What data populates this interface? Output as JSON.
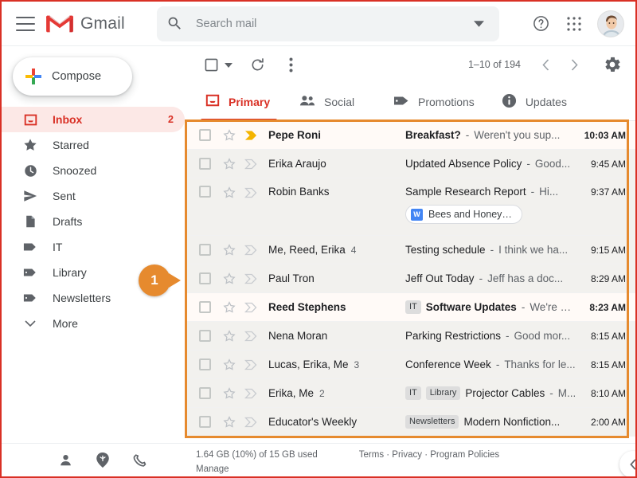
{
  "header": {
    "menu_icon": "hamburger-menu-icon",
    "brand": "Gmail",
    "search_placeholder": "Search mail",
    "search_value": "",
    "help_icon": "help-icon",
    "apps_icon": "apps-grid-icon",
    "avatar_alt": "account-avatar"
  },
  "sidebar": {
    "compose_label": "Compose",
    "items": [
      {
        "label": "Inbox",
        "icon": "inbox-icon",
        "count": "2",
        "active": true
      },
      {
        "label": "Starred",
        "icon": "star-icon",
        "count": "",
        "active": false
      },
      {
        "label": "Snoozed",
        "icon": "clock-icon",
        "count": "",
        "active": false
      },
      {
        "label": "Sent",
        "icon": "send-icon",
        "count": "",
        "active": false
      },
      {
        "label": "Drafts",
        "icon": "draft-icon",
        "count": "",
        "active": false
      },
      {
        "label": "IT",
        "icon": "label-icon",
        "count": "",
        "active": false
      },
      {
        "label": "Library",
        "icon": "label-icon",
        "count": "",
        "active": false
      },
      {
        "label": "Newsletters",
        "icon": "label-icon",
        "count": "",
        "active": false
      },
      {
        "label": "More",
        "icon": "chevron-down-icon",
        "count": "",
        "active": false
      }
    ]
  },
  "toolbar": {
    "select_all_icon": "select-all-checkbox",
    "refresh_icon": "refresh-icon",
    "more_icon": "more-vertical-icon",
    "page_range": "1–10 of 194",
    "prev_icon": "chevron-left-icon",
    "next_icon": "chevron-right-icon",
    "settings_icon": "gear-icon"
  },
  "tabs": [
    {
      "label": "Primary",
      "icon": "inbox-icon",
      "active": true
    },
    {
      "label": "Social",
      "icon": "people-icon",
      "active": false
    },
    {
      "label": "Promotions",
      "icon": "tag-icon",
      "active": false
    },
    {
      "label": "Updates",
      "icon": "info-icon",
      "active": false
    }
  ],
  "emails": [
    {
      "sender": "Pepe Roni",
      "count": "",
      "unread": true,
      "important": true,
      "labels": [],
      "subject": "Breakfast?",
      "snippet": "Weren't you sup...",
      "time": "10:03 AM",
      "attachment": ""
    },
    {
      "sender": "Erika Araujo",
      "count": "",
      "unread": false,
      "important": false,
      "labels": [],
      "subject": "Updated Absence Policy",
      "snippet": "Good...",
      "time": "9:45 AM",
      "attachment": ""
    },
    {
      "sender": "Robin Banks",
      "count": "",
      "unread": false,
      "important": false,
      "labels": [],
      "subject": "Sample Research Report",
      "snippet": "Hi...",
      "time": "9:37 AM",
      "attachment": "Bees and Honey…"
    },
    {
      "sender": "Me, Reed, Erika",
      "count": "4",
      "unread": false,
      "important": false,
      "labels": [],
      "subject": "Testing schedule",
      "snippet": "I think we ha...",
      "time": "9:15 AM",
      "attachment": ""
    },
    {
      "sender": "Paul Tron",
      "count": "",
      "unread": false,
      "important": false,
      "labels": [],
      "subject": "Jeff Out Today",
      "snippet": "Jeff has a doc...",
      "time": "8:29 AM",
      "attachment": ""
    },
    {
      "sender": "Reed Stephens",
      "count": "",
      "unread": true,
      "important": false,
      "labels": [
        "IT"
      ],
      "subject": "Software Updates",
      "snippet": "We're go...",
      "time": "8:23 AM",
      "attachment": ""
    },
    {
      "sender": "Nena Moran",
      "count": "",
      "unread": false,
      "important": false,
      "labels": [],
      "subject": "Parking Restrictions",
      "snippet": "Good mor...",
      "time": "8:15 AM",
      "attachment": ""
    },
    {
      "sender": "Lucas, Erika, Me",
      "count": "3",
      "unread": false,
      "important": false,
      "labels": [],
      "subject": "Conference Week",
      "snippet": "Thanks for le...",
      "time": "8:15 AM",
      "attachment": ""
    },
    {
      "sender": "Erika, Me",
      "count": "2",
      "unread": false,
      "important": false,
      "labels": [
        "IT",
        "Library"
      ],
      "subject": "Projector Cables",
      "snippet": "M...",
      "time": "8:10 AM",
      "attachment": ""
    },
    {
      "sender": "Educator's Weekly",
      "count": "",
      "unread": false,
      "important": false,
      "labels": [
        "Newsletters"
      ],
      "subject": "Modern Nonfiction...",
      "snippet": "",
      "time": "2:00 AM",
      "attachment": ""
    }
  ],
  "footer": {
    "contacts_icon": "person-icon",
    "chat_icon": "chat-icon",
    "phone_icon": "phone-icon",
    "storage": "1.64 GB (10%) of 15 GB used",
    "manage": "Manage",
    "links": "Terms · Privacy · Program Policies",
    "collapse_icon": "chevron-left-icon"
  },
  "annotation": {
    "badge": "1",
    "highlight_color": "#e68a2e"
  }
}
